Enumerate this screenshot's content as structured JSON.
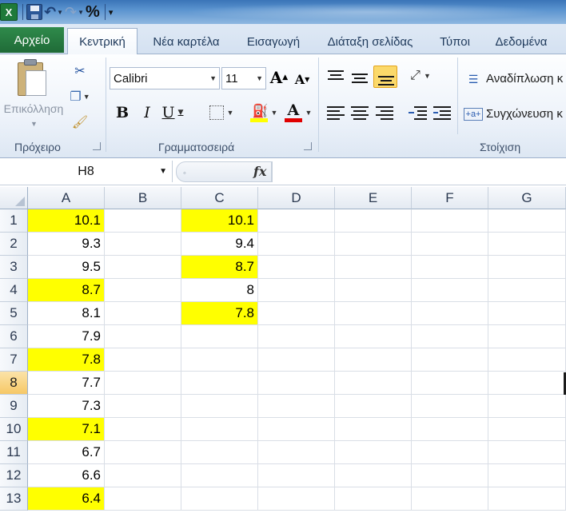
{
  "window": {
    "title_blurred": ""
  },
  "qat": {
    "percent_label": "%"
  },
  "tabs": [
    {
      "label": "Αρχείο",
      "kind": "file"
    },
    {
      "label": "Κεντρική",
      "active": true
    },
    {
      "label": "Νέα καρτέλα"
    },
    {
      "label": "Εισαγωγή"
    },
    {
      "label": "Διάταξη σελίδας"
    },
    {
      "label": "Τύποι"
    },
    {
      "label": "Δεδομένα"
    }
  ],
  "ribbon": {
    "clipboard": {
      "paste_label": "Επικόλληση",
      "group_label": "Πρόχειρο"
    },
    "font": {
      "font_name": "Calibri",
      "font_size": "11",
      "bold": "B",
      "italic": "I",
      "underline": "U",
      "group_label": "Γραμματοσειρά",
      "grow": "A",
      "shrink": "A",
      "font_color_letter": "A"
    },
    "alignment": {
      "wrap_text": "Αναδίπλωση κ",
      "merge_center": "Συγχώνευση κ",
      "group_label": "Στοίχιση"
    }
  },
  "formula_bar": {
    "name_box": "H8",
    "fx": "fx",
    "formula": ""
  },
  "sheet": {
    "columns": [
      "A",
      "B",
      "C",
      "D",
      "E",
      "F",
      "G"
    ],
    "rows": [
      "1",
      "2",
      "3",
      "4",
      "5",
      "6",
      "7",
      "8",
      "9",
      "10",
      "11",
      "12",
      "13"
    ],
    "selected_row": "8",
    "highlight_color": "#ffff00",
    "colA": [
      "10.1",
      "9.3",
      "9.5",
      "8.7",
      "8.1",
      "7.9",
      "7.8",
      "7.7",
      "7.3",
      "7.1",
      "6.7",
      "6.6",
      "6.4"
    ],
    "colA_highlight": [
      true,
      false,
      false,
      true,
      false,
      false,
      true,
      false,
      false,
      true,
      false,
      false,
      true
    ],
    "colC": [
      "10.1",
      "9.4",
      "8.7",
      "8",
      "7.8",
      "",
      "",
      "",
      "",
      "",
      "",
      "",
      ""
    ],
    "colC_highlight": [
      true,
      false,
      true,
      false,
      true,
      false,
      false,
      false,
      false,
      false,
      false,
      false,
      false
    ]
  }
}
